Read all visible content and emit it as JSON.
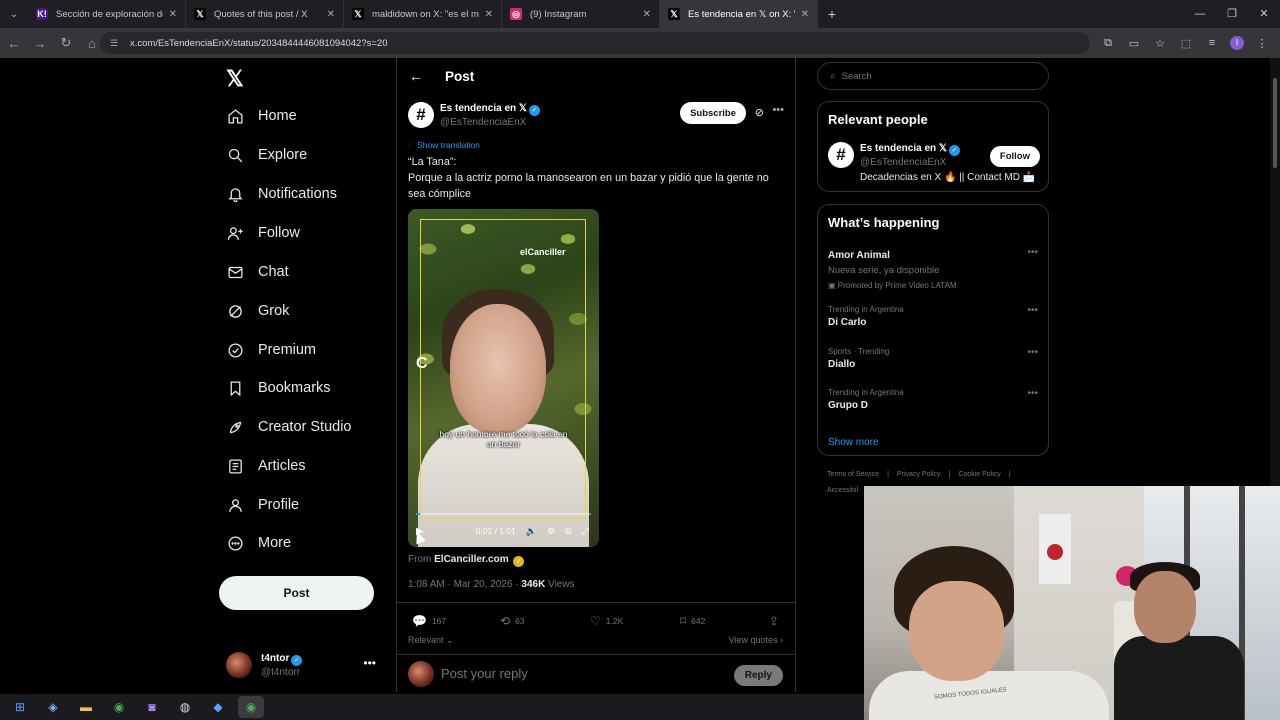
{
  "browser": {
    "tabs": [
      {
        "title": "Sección de exploración de kah",
        "icon": "kahoot-icon",
        "color": "#46178f",
        "glyph": "K!",
        "active": false
      },
      {
        "title": "Quotes of this post / X",
        "icon": "x-icon",
        "color": "#000000",
        "glyph": "𝕏",
        "active": false
      },
      {
        "title": "maldidown on X: \"es el mejor c",
        "icon": "x-icon",
        "color": "#000000",
        "glyph": "𝕏",
        "active": false
      },
      {
        "title": "(9) Instagram",
        "icon": "instagram-icon",
        "color": "#d62976",
        "glyph": "◎",
        "active": false
      },
      {
        "title": "Es tendencia en 𝕏 on X: \"\"Li",
        "icon": "x-icon",
        "color": "#000000",
        "glyph": "𝕏",
        "active": true
      }
    ],
    "url": "x.com/EsTendenciaEnX/status/2034844446081094042?s=20"
  },
  "nav": {
    "items": [
      {
        "label": "Home",
        "icon": "home-icon"
      },
      {
        "label": "Explore",
        "icon": "search-icon"
      },
      {
        "label": "Notifications",
        "icon": "bell-icon"
      },
      {
        "label": "Follow",
        "icon": "add-person-icon"
      },
      {
        "label": "Chat",
        "icon": "mail-icon"
      },
      {
        "label": "Grok",
        "icon": "grok-icon"
      },
      {
        "label": "Premium",
        "icon": "verified-badge-icon"
      },
      {
        "label": "Bookmarks",
        "icon": "bookmark-icon"
      },
      {
        "label": "Creator Studio",
        "icon": "rocket-icon"
      },
      {
        "label": "Articles",
        "icon": "article-icon"
      },
      {
        "label": "Profile",
        "icon": "person-icon"
      },
      {
        "label": "More",
        "icon": "more-circle-icon"
      }
    ],
    "post_label": "Post",
    "account": {
      "name": "t4ntor",
      "handle": "@t4ntorr"
    }
  },
  "post": {
    "header_title": "Post",
    "author_name": "Es tendencia en 𝕏",
    "author_handle": "@EsTendenciaEnX",
    "subscribe_label": "Subscribe",
    "show_translation": "Show translation",
    "text_line1": "“La Tana”:",
    "text_line2": "Porque a la actriz porno la manosearon en un bazar y pidió que la gente no sea cómplice",
    "video": {
      "watermark": "elCanciller",
      "caption": "hoy un hombre me tocó la cola en un bazar",
      "time": "0:01 / 1:01",
      "progress": 0.02
    },
    "from_label": "From",
    "source": "ElCanciller.com",
    "timestamp": "1:08 AM · Mar 20, 2026 · ",
    "views_count": "346K",
    "views_label": " Views",
    "replies": "167",
    "reposts": "63",
    "likes": "1.2K",
    "bookmarks": "642",
    "relevant_label": "Relevant",
    "view_quotes_label": "View quotes",
    "reply_placeholder": "Post your reply",
    "reply_button": "Reply"
  },
  "sidebar": {
    "search_placeholder": "Search",
    "relevant_people_title": "Relevant people",
    "person": {
      "name": "Es tendencia en 𝕏",
      "handle": "@EsTendenciaEnX",
      "bio": "Decadencias en X 🔥 || Contact MD 📩",
      "follow_label": "Follow"
    },
    "whats_happening_title": "What’s happening",
    "trends": [
      {
        "context": "",
        "name": "Amor Animal",
        "sub": "Nueva serie, ya disponible",
        "promo": "Promoted by Prime Video LATAM"
      },
      {
        "context": "Trending in Argentina",
        "name": "Di Carlo",
        "sub": "",
        "promo": ""
      },
      {
        "context": "Sports · Trending",
        "name": "Diallo",
        "sub": "",
        "promo": ""
      },
      {
        "context": "Trending in Argentina",
        "name": "Grupo D",
        "sub": "",
        "promo": ""
      }
    ],
    "show_more": "Show more",
    "footer_links": [
      "Terms of Service",
      "Privacy Policy",
      "Cookie Policy"
    ],
    "footer_more": "Accessibil"
  },
  "webcam": {
    "shirt_text": "SOMOS TODOS IGUALES"
  }
}
